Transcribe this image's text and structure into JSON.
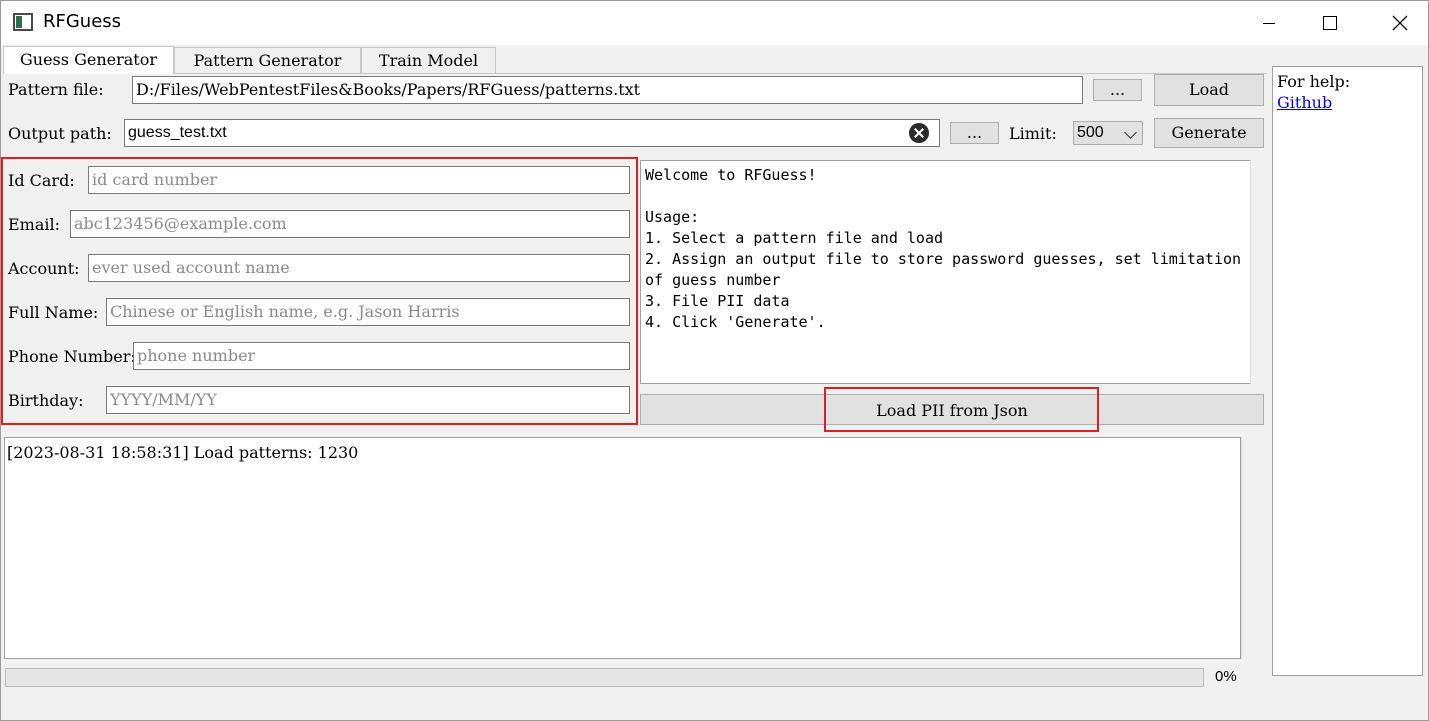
{
  "window": {
    "title": "RFGuess"
  },
  "tabs": [
    {
      "label": "Guess Generator",
      "active": true
    },
    {
      "label": "Pattern Generator",
      "active": false
    },
    {
      "label": "Train Model",
      "active": false
    }
  ],
  "pattern": {
    "label": "Pattern file:",
    "value": "D:/Files/WebPentestFiles&Books/Papers/RFGuess/patterns.txt",
    "browse_label": "...",
    "load_label": "Load"
  },
  "output": {
    "label": "Output path:",
    "value": "guess_test.txt",
    "browse_label": "...",
    "limit_label": "Limit:",
    "limit_value": "500",
    "generate_label": "Generate"
  },
  "pii": {
    "id_card": {
      "label": "Id Card:",
      "placeholder": "id card number"
    },
    "email": {
      "label": "Email:",
      "placeholder": "abc123456@example.com"
    },
    "account": {
      "label": "Account:",
      "placeholder": "ever used account name"
    },
    "full_name": {
      "label": "Full Name:",
      "placeholder": "Chinese or English name, e.g. Jason Harris"
    },
    "phone": {
      "label": "Phone Number:",
      "placeholder": "phone number"
    },
    "birthday": {
      "label": "Birthday:",
      "placeholder": "YYYY/MM/YY"
    }
  },
  "welcome_text": "Welcome to RFGuess!\n\nUsage:\n1. Select a pattern file and load\n2. Assign an output file to store password guesses, set limitation of guess number\n3. File PII data\n4. Click 'Generate'.",
  "load_pii_label": "Load PII from Json",
  "log_text": "[2023-08-31 18:58:31] Load patterns: 1230",
  "progress": {
    "value": 0,
    "label": "0%"
  },
  "help": {
    "text": "For help:",
    "link": "Github"
  },
  "colors": {
    "highlight": "#e02020",
    "link": "#0000ee"
  }
}
